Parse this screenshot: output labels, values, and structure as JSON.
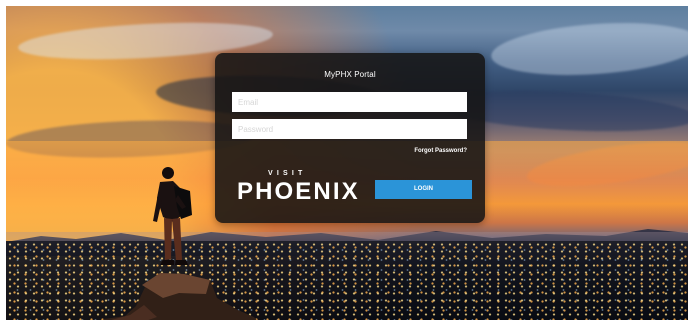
{
  "portal": {
    "title": "MyPHX Portal",
    "email_placeholder": "Email",
    "password_placeholder": "Password",
    "forgot_password": "Forgot Password?",
    "login_button": "LOGIN",
    "brand_top": "VISIT",
    "brand_name": "PHOENIX"
  },
  "colors": {
    "panel_background": "#161414",
    "button_background": "#2B94D8",
    "text_primary": "#FFFFFF"
  },
  "icons": {
    "background_image": "sunset-city-hiker-image",
    "brand_logo": "visit-phoenix-logo"
  }
}
